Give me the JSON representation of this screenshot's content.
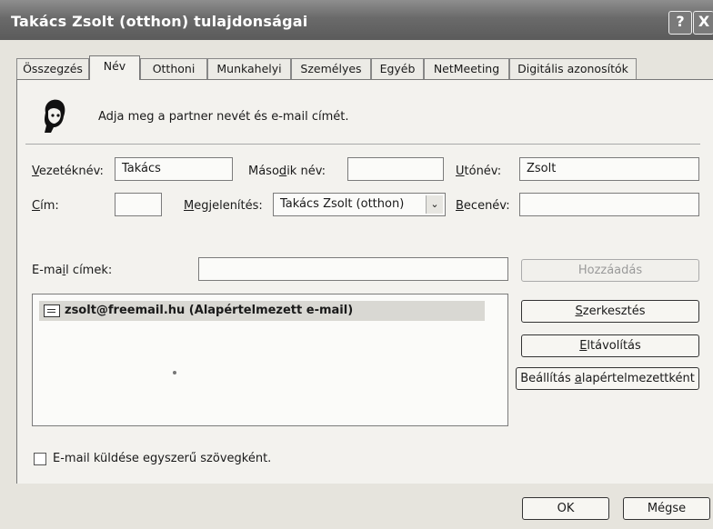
{
  "window": {
    "title": "Takács Zsolt (otthon) tulajdonságai",
    "help_glyph": "?",
    "close_glyph": "X"
  },
  "tabs": [
    {
      "label": "Összegzés"
    },
    {
      "label": "Név"
    },
    {
      "label": "Otthoni"
    },
    {
      "label": "Munkahelyi"
    },
    {
      "label": "Személyes"
    },
    {
      "label": "Egyéb"
    },
    {
      "label": "NetMeeting"
    },
    {
      "label": "Digitális azonosítók"
    }
  ],
  "header": {
    "icon": "person-head-icon",
    "instructions": "Adja meg a partner nevét és e-mail címét."
  },
  "name_fields": {
    "lastname_label": "Vezetéknév:",
    "lastname_value": "Takács",
    "middlename_label": "Második név:",
    "middlename_value": "",
    "firstname_label": "Utónév:",
    "firstname_value": "Zsolt",
    "title_label": "Cím:",
    "title_value": "",
    "display_label": "Megjelenítés:",
    "display_value": "Takács Zsolt (otthon)",
    "nickname_label": "Becenév:",
    "nickname_value": ""
  },
  "email": {
    "label": "E-mail címek:",
    "input_value": "",
    "add_button": "Hozzáadás",
    "edit_button": "Szerkesztés",
    "remove_button": "Eltávolítás",
    "default_button": "Beállítás alapértelmezettként",
    "list": [
      {
        "text": "zsolt@freemail.hu  (Alapértelmezett e-mail)"
      }
    ]
  },
  "plain_text": {
    "label": "E-mail küldése egyszerű szövegként.",
    "checked": false
  },
  "footer": {
    "ok_button": "OK",
    "cancel_button": "Mégse"
  }
}
